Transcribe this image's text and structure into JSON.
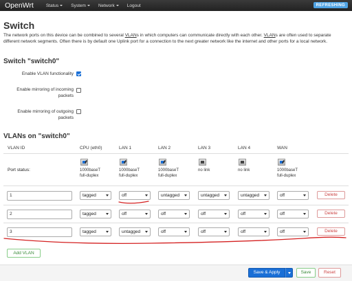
{
  "navbar": {
    "brand": "OpenWrt",
    "menus": [
      "Status",
      "System",
      "Network"
    ],
    "logout": "Logout",
    "badge": "REFRESHING",
    "badge_color": "#4fa3e4"
  },
  "page": {
    "title": "Switch",
    "description_parts": [
      "The network ports on this device can be combined to several ",
      "VLAN",
      "s in which computers can communicate directly with each other. ",
      "VLAN",
      "s are often used to separate different network segments. Often there is by default one Uplink port for a connection to the next greater network like the internet and other ports for a local network."
    ]
  },
  "switch_section": {
    "title": "Switch \"switch0\"",
    "options": [
      {
        "label": "Enable VLAN functionality",
        "checked": true
      },
      {
        "label": "Enable mirroring of incoming packets",
        "checked": false
      },
      {
        "label": "Enable mirroring of outgoing packets",
        "checked": false
      }
    ]
  },
  "vlan_section": {
    "title": "VLANs on \"switch0\"",
    "columns": [
      "VLAN ID",
      "CPU (eth0)",
      "LAN 1",
      "LAN 2",
      "LAN 3",
      "LAN 4",
      "WAN"
    ],
    "port_status_label": "Port status:",
    "port_status": [
      {
        "icon": "port-up-icon",
        "line1": "1000baseT",
        "line2": "full-duplex"
      },
      {
        "icon": "port-up-icon",
        "line1": "1000baseT",
        "line2": "full-duplex"
      },
      {
        "icon": "port-up-icon",
        "line1": "1000baseT",
        "line2": "full-duplex"
      },
      {
        "icon": "port-down-icon",
        "line1": "no link",
        "line2": ""
      },
      {
        "icon": "port-down-icon",
        "line1": "no link",
        "line2": ""
      },
      {
        "icon": "port-up-icon",
        "line1": "1000baseT",
        "line2": "full-duplex"
      }
    ],
    "rows": [
      {
        "vlan_id": "1",
        "ports": [
          "tagged",
          "off",
          "untagged",
          "untagged",
          "untagged",
          "off"
        ],
        "delete": "Delete"
      },
      {
        "vlan_id": "2",
        "ports": [
          "tagged",
          "off",
          "off",
          "off",
          "off",
          "off"
        ],
        "delete": "Delete"
      },
      {
        "vlan_id": "3",
        "ports": [
          "tagged",
          "untagged",
          "off",
          "off",
          "off",
          "off"
        ],
        "delete": "Delete"
      }
    ],
    "add_button": "Add VLAN"
  },
  "footer": {
    "save_apply": "Save & Apply",
    "save": "Save",
    "reset": "Reset",
    "primary_color": "#1a6fd6"
  },
  "annotation_color": "#d42020"
}
